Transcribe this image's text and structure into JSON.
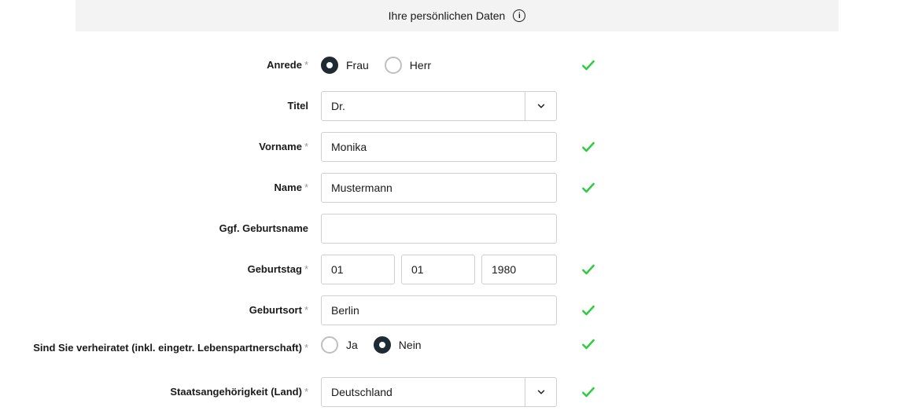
{
  "header": {
    "title": "Ihre persönlichen Daten"
  },
  "labels": {
    "anrede": "Anrede",
    "titel": "Titel",
    "vorname": "Vorname",
    "name": "Name",
    "geburtsname": "Ggf. Geburtsname",
    "geburtstag": "Geburtstag",
    "geburtsort": "Geburtsort",
    "verheiratet": "Sind Sie verheiratet (inkl. eingetr. Lebenspartnerschaft)",
    "staatsangehoerigkeit": "Staatsangehörigkeit (Land)"
  },
  "options": {
    "anrede_frau": "Frau",
    "anrede_herr": "Herr",
    "verheiratet_ja": "Ja",
    "verheiratet_nein": "Nein"
  },
  "values": {
    "anrede_selected": "Frau",
    "titel": "Dr.",
    "vorname": "Monika",
    "name": "Mustermann",
    "geburtsname": "",
    "geburtstag_tag": "01",
    "geburtstag_monat": "01",
    "geburtstag_jahr": "1980",
    "geburtsort": "Berlin",
    "verheiratet_selected": "Nein",
    "staatsangehoerigkeit": "Deutschland"
  },
  "valid": {
    "anrede": true,
    "vorname": true,
    "name": true,
    "geburtstag": true,
    "geburtsort": true,
    "verheiratet": true,
    "staatsangehoerigkeit": true
  }
}
